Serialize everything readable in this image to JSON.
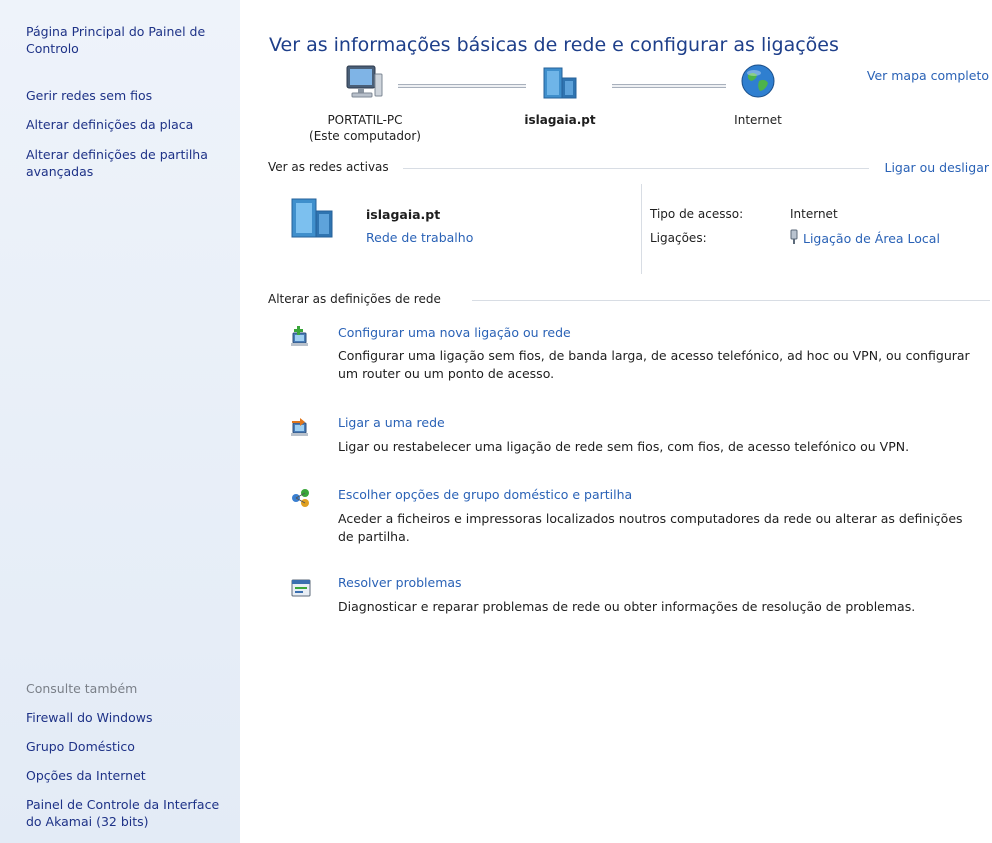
{
  "sidebar": {
    "links": [
      "Página Principal do Painel de Controlo",
      "Gerir redes sem fios",
      "Alterar definições da placa",
      "Alterar definições de partilha avançadas"
    ],
    "see_also_heading": "Consulte também",
    "see_also": [
      "Firewall do Windows",
      "Grupo Doméstico",
      "Opções da Internet",
      "Painel de Controle da Interface do Akamai (32 bits)"
    ]
  },
  "main": {
    "title": "Ver as informações básicas de rede e configurar as ligações",
    "full_map_link": "Ver mapa completo",
    "map": {
      "computer_name": "PORTATIL-PC",
      "computer_note": "(Este computador)",
      "network_name": "islagaia.pt",
      "internet_label": "Internet"
    },
    "active_networks": {
      "heading": "Ver as redes activas",
      "connect_link": "Ligar ou desligar",
      "network_name": "islagaia.pt",
      "network_type": "Rede de trabalho",
      "access_type_label": "Tipo de acesso:",
      "access_type_value": "Internet",
      "connections_label": "Ligações:",
      "connections_value": "Ligação de Área Local"
    },
    "change_settings": {
      "heading": "Alterar as definições de rede",
      "tasks": [
        {
          "title": "Configurar uma nova ligação ou rede",
          "desc": "Configurar uma ligação sem fios, de banda larga, de acesso telefónico, ad hoc ou VPN, ou configurar um router ou um ponto de acesso.",
          "icon": "new-connection-icon"
        },
        {
          "title": "Ligar a uma rede",
          "desc": "Ligar ou restabelecer uma ligação de rede sem fios, com fios, de acesso telefónico ou VPN.",
          "icon": "connect-network-icon"
        },
        {
          "title": "Escolher opções de grupo doméstico e partilha",
          "desc": "Aceder a ficheiros e impressoras localizados noutros computadores da rede ou alterar as definições de partilha.",
          "icon": "homegroup-icon"
        },
        {
          "title": "Resolver problemas",
          "desc": "Diagnosticar e reparar problemas de rede ou obter informações de resolução de problemas.",
          "icon": "troubleshoot-icon"
        }
      ]
    }
  },
  "colors": {
    "sidebar_bg": "#e7eef8",
    "link": "#2a62b6",
    "title": "#1e3f8a",
    "sidebar_link": "#1e3287"
  }
}
